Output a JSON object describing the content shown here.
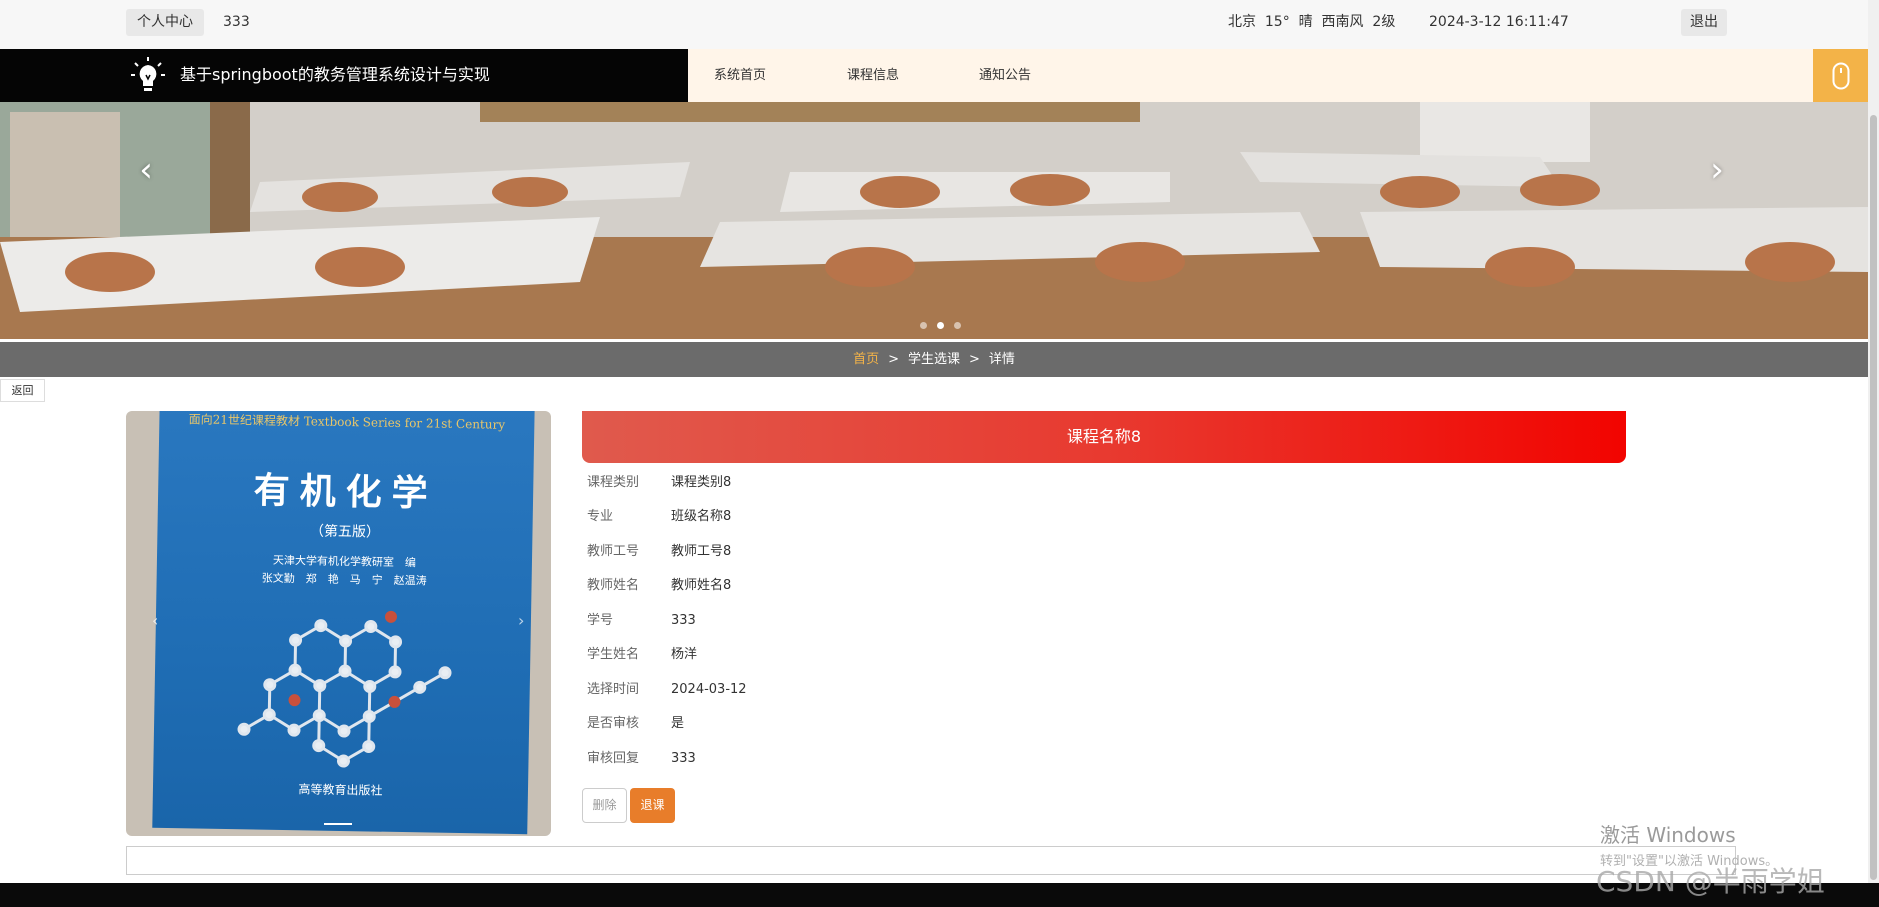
{
  "topbar": {
    "personal_center": "个人中心",
    "username": "333",
    "weather": "北京  15°  晴  西南风  2级",
    "datetime": "2024-3-12 16:11:47",
    "logout": "退出"
  },
  "header": {
    "title": "基于springboot的教务管理系统设计与实现",
    "nav": [
      "系统首页",
      "课程信息",
      "通知公告"
    ],
    "brand_icon": "lightbulb-icon",
    "right_icon": "mouse-icon"
  },
  "banner": {
    "prev": "‹",
    "next": "›",
    "dots": 3,
    "active_dot": 2
  },
  "breadcrumb": {
    "home": "首页",
    "sep": ">",
    "section": "学生选课",
    "current": "详情"
  },
  "back_button": "返回",
  "book_image": {
    "series": "面向21世纪课程教材  Textbook Series for 21st Century",
    "title": "有机化学",
    "edition": "（第五版）",
    "authors_line1": "天津大学有机化学教研室　编",
    "authors_line2": "张文勤　郑　艳　马　宁　赵温涛",
    "publisher": "高等教育出版社"
  },
  "detail": {
    "course_name": "课程名称8",
    "fields": [
      {
        "label": "课程类别",
        "value": "课程类别8"
      },
      {
        "label": "专业",
        "value": "班级名称8"
      },
      {
        "label": "教师工号",
        "value": "教师工号8"
      },
      {
        "label": "教师姓名",
        "value": "教师姓名8"
      },
      {
        "label": "学号",
        "value": "333"
      },
      {
        "label": "学生姓名",
        "value": "杨洋"
      },
      {
        "label": "选择时间",
        "value": "2024-03-12"
      },
      {
        "label": "是否审核",
        "value": "是"
      },
      {
        "label": "审核回复",
        "value": "333"
      }
    ],
    "delete_label": "删除",
    "drop_label": "退课"
  },
  "watermark": {
    "line1": "激活 Windows",
    "line2": "转到\"设置\"以激活 Windows。",
    "csdn": "CSDN @半雨学姐"
  },
  "colors": {
    "accent": "#f3b348",
    "title_red": "#f20400",
    "drop_orange": "#e87d2a"
  }
}
